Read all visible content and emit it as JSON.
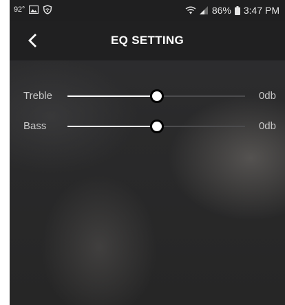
{
  "status_bar": {
    "temperature": "92°",
    "battery_percent": "86%",
    "time": "3:47 PM",
    "icons": [
      "image-icon",
      "shield-wifi-icon",
      "wifi-icon",
      "signal-icon",
      "battery-icon"
    ]
  },
  "header": {
    "title": "EQ SETTING",
    "back_icon": "chevron-left-icon"
  },
  "eq": {
    "treble": {
      "label": "Treble",
      "value_text": "0db",
      "level": 0.5
    },
    "bass": {
      "label": "Bass",
      "value_text": "0db",
      "level": 0.5
    }
  },
  "colors": {
    "accent": "#ffffff",
    "track_inactive": "#4c4c4e",
    "header_bg": "#202021",
    "text_muted": "#c9c9c9"
  }
}
